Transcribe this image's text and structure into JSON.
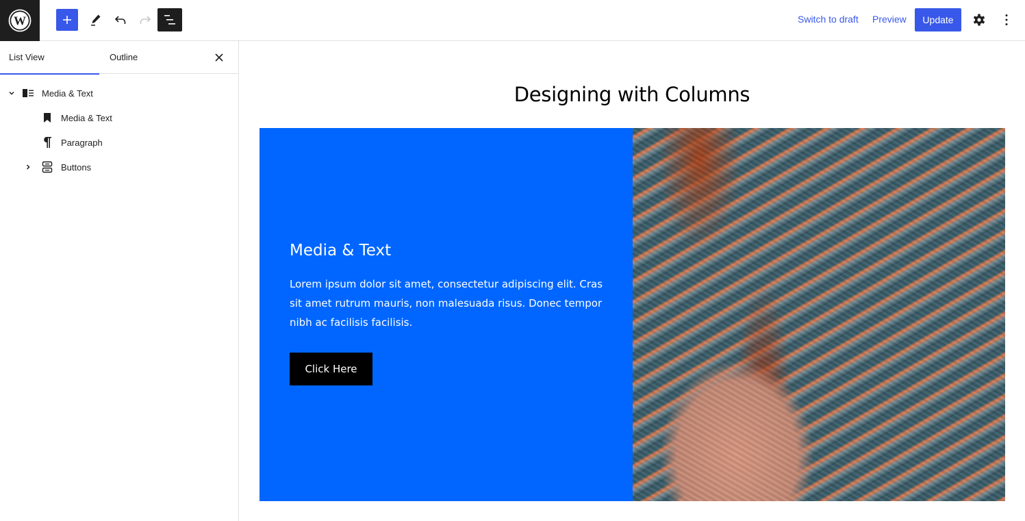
{
  "toolbar": {
    "add_block_label": "Add block",
    "tools_label": "Tools",
    "undo_label": "Undo",
    "redo_label": "Redo",
    "document_overview_label": "Document Overview",
    "switch_to_draft": "Switch to draft",
    "preview": "Preview",
    "update": "Update",
    "settings_label": "Settings",
    "options_label": "Options"
  },
  "sidebar": {
    "tabs": [
      {
        "label": "List View",
        "active": true
      },
      {
        "label": "Outline",
        "active": false
      }
    ],
    "close_label": "Close",
    "tree": [
      {
        "label": "Media & Text",
        "icon": "media-text-icon",
        "level": 1,
        "expanded": true
      },
      {
        "label": "Media & Text",
        "icon": "bookmark-icon",
        "level": 2
      },
      {
        "label": "Paragraph",
        "icon": "paragraph-icon",
        "level": 2
      },
      {
        "label": "Buttons",
        "icon": "buttons-icon",
        "level": 2,
        "expanded": false
      }
    ]
  },
  "canvas": {
    "post_title": "Designing with Columns",
    "media_text": {
      "heading": "Media & Text",
      "paragraph": "Lorem ipsum dolor sit amet, consectetur adipiscing elit. Cras sit amet rutrum mauris, non malesuada risus. Donec tempor nibh ac facilisis facilisis.",
      "button": "Click Here",
      "background_color": "#0066ff",
      "media_alt": "Aerial image of Mars sand dunes"
    }
  },
  "colors": {
    "accent": "#3858e9",
    "dark": "#1e1e1e"
  }
}
